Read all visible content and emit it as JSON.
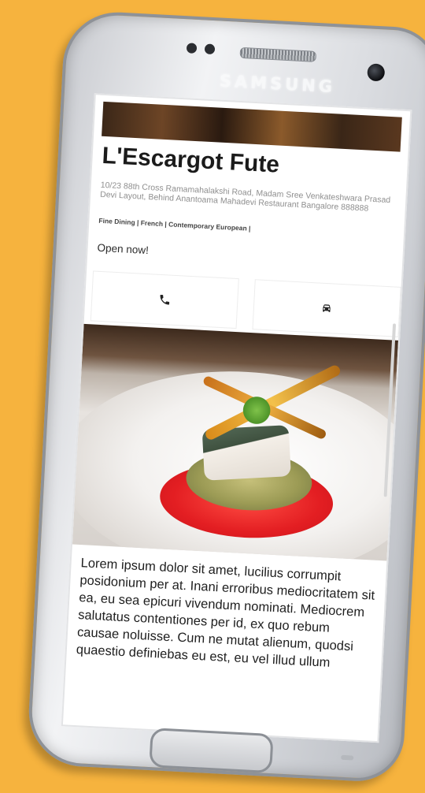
{
  "device": {
    "brand": "SAMSUNG"
  },
  "restaurant": {
    "name": "L'Escargot Fute",
    "address": "10/23 88th Cross Ramamahalakshi Road, Madam Sree Venkateshwara Prasad Devi Layout, Behind Anantoama Mahadevi Restaurant Bangalore 888888",
    "tags": "Fine Dining | French | Contemporary European |",
    "status": "Open now!",
    "description": "Lorem ipsum dolor sit amet, lucilius corrumpit posidonium per at. Inani erroribus mediocritatem sit ea, eu sea epicuri vivendum nominati. Mediocrem salutatus contentiones per id, ex quo rebum causae noluisse. Cum ne mutat alienum, quodsi quaestio definiebas eu est, eu vel illud ullum"
  },
  "actions": [
    {
      "icon": "phone-icon"
    },
    {
      "icon": "car-icon"
    }
  ]
}
